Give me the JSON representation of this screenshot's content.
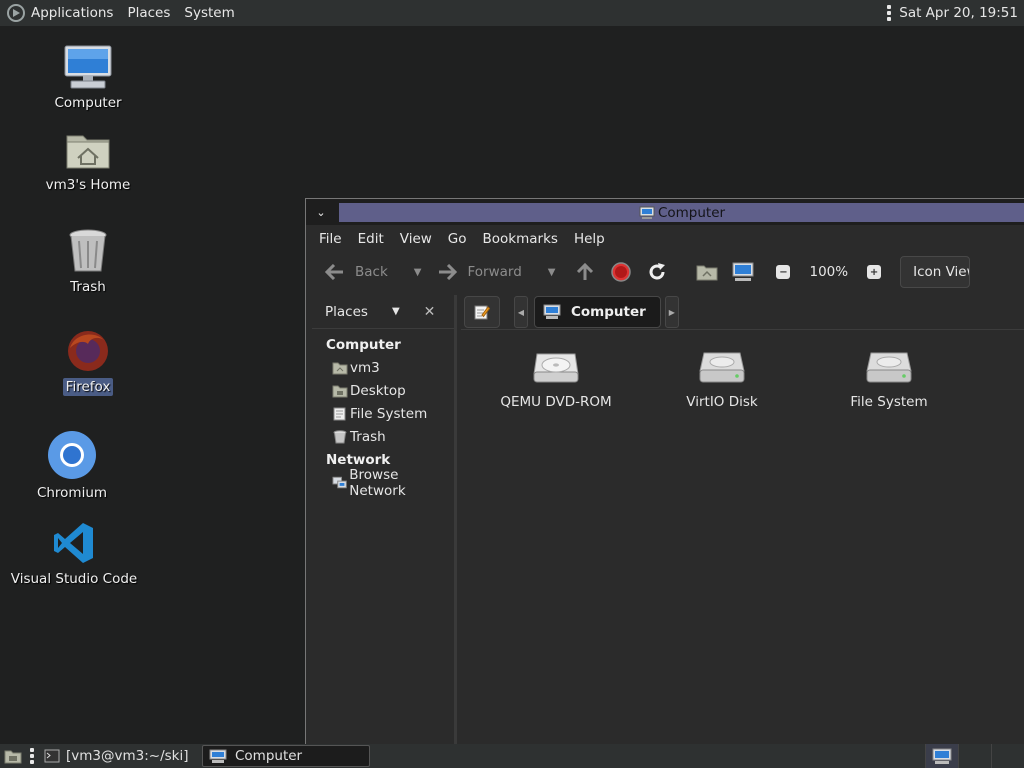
{
  "top_panel": {
    "applications": "Applications",
    "places": "Places",
    "system": "System",
    "clock": "Sat Apr 20, 19:51"
  },
  "desktop": {
    "icons": [
      {
        "label": "Computer",
        "icon": "computer-icon"
      },
      {
        "label": "vm3's Home",
        "icon": "home-folder-icon"
      },
      {
        "label": "Trash",
        "icon": "trash-icon"
      },
      {
        "label": "Firefox",
        "icon": "firefox-icon"
      },
      {
        "label": "Chromium",
        "icon": "chromium-icon"
      },
      {
        "label": "Visual Studio Code",
        "icon": "vscode-icon"
      }
    ]
  },
  "window": {
    "title": "Computer",
    "menu": [
      "File",
      "Edit",
      "View",
      "Go",
      "Bookmarks",
      "Help"
    ],
    "toolbar": {
      "back": "Back",
      "forward": "Forward",
      "zoom": "100%",
      "view_mode": "Icon View"
    },
    "sidebar": {
      "header": "Places",
      "groups": [
        {
          "title": "Computer",
          "items": [
            "vm3",
            "Desktop",
            "File System",
            "Trash"
          ]
        },
        {
          "title": "Network",
          "items": [
            "Browse Network"
          ]
        }
      ]
    },
    "location": {
      "crumb": "Computer"
    },
    "drives": [
      {
        "label": "QEMU DVD-ROM",
        "icon": "optical-drive-icon"
      },
      {
        "label": "VirtIO Disk",
        "icon": "hard-disk-icon"
      },
      {
        "label": "File System",
        "icon": "hard-disk-icon"
      }
    ]
  },
  "taskbar": {
    "tasks": [
      "[vm3@vm3:~/ski]",
      "Computer"
    ]
  },
  "colors": {
    "desktop_bg": "#1f2020",
    "panel_bg": "#2e3131",
    "title_active": "#5f5f8a",
    "selection": "#4a5c85"
  }
}
